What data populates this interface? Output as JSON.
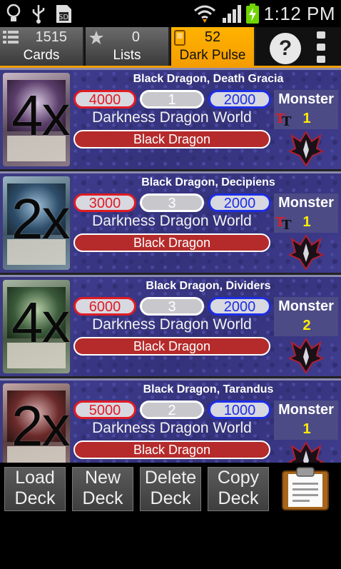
{
  "status": {
    "time": "1:12 PM",
    "icons": [
      "lightbulb-icon",
      "usb-icon",
      "sd-card-icon",
      "wifi-icon",
      "signal-icon",
      "battery-charging-icon"
    ]
  },
  "tabs": [
    {
      "count": "1515",
      "label": "Cards",
      "icon": "list-icon"
    },
    {
      "count": "0",
      "label": "Lists",
      "icon": "star-icon"
    },
    {
      "count": "52",
      "label": "Dark Pulse",
      "icon": "card-icon"
    }
  ],
  "toolbar": {
    "help_label": "?"
  },
  "cards": [
    {
      "qty": "4x",
      "name": "Black Dragon, Death Gracia",
      "power": "4000",
      "critical": "1",
      "defense": "2000",
      "world": "Darkness Dragon World",
      "attribute": "Black Dragon",
      "type": "Monster",
      "size": "1",
      "tt": true,
      "accent": "#7a1f2b"
    },
    {
      "qty": "2x",
      "name": "Black Dragon, Decipiens",
      "power": "3000",
      "critical": "3",
      "defense": "2000",
      "world": "Darkness Dragon World",
      "attribute": "Black Dragon",
      "type": "Monster",
      "size": "1",
      "tt": true,
      "accent": "#2b4f6b"
    },
    {
      "qty": "4x",
      "name": "Black Dragon, Dividers",
      "power": "6000",
      "critical": "3",
      "defense": "2000",
      "world": "Darkness Dragon World",
      "attribute": "Black Dragon",
      "type": "Monster",
      "size": "2",
      "tt": false,
      "accent": "#3a5a3a"
    },
    {
      "qty": "2x",
      "name": "Black Dragon, Tarandus",
      "power": "5000",
      "critical": "2",
      "defense": "1000",
      "world": "Darkness Dragon World",
      "attribute": "Black Dragon",
      "type": "Monster",
      "size": "1",
      "tt": false,
      "accent": "#6b2a2a"
    }
  ],
  "bottom": {
    "load": [
      "Load",
      "Deck"
    ],
    "new": [
      "New",
      "Deck"
    ],
    "delete": [
      "Delete",
      "Deck"
    ],
    "copy": [
      "Copy",
      "Deck"
    ],
    "clipboard_icon": "clipboard-icon"
  },
  "colors": {
    "accent": "#f59d00",
    "power": "#e01b24",
    "defense": "#1c2ee6",
    "attribute": "#b52b2b",
    "size": "#ffee00"
  }
}
